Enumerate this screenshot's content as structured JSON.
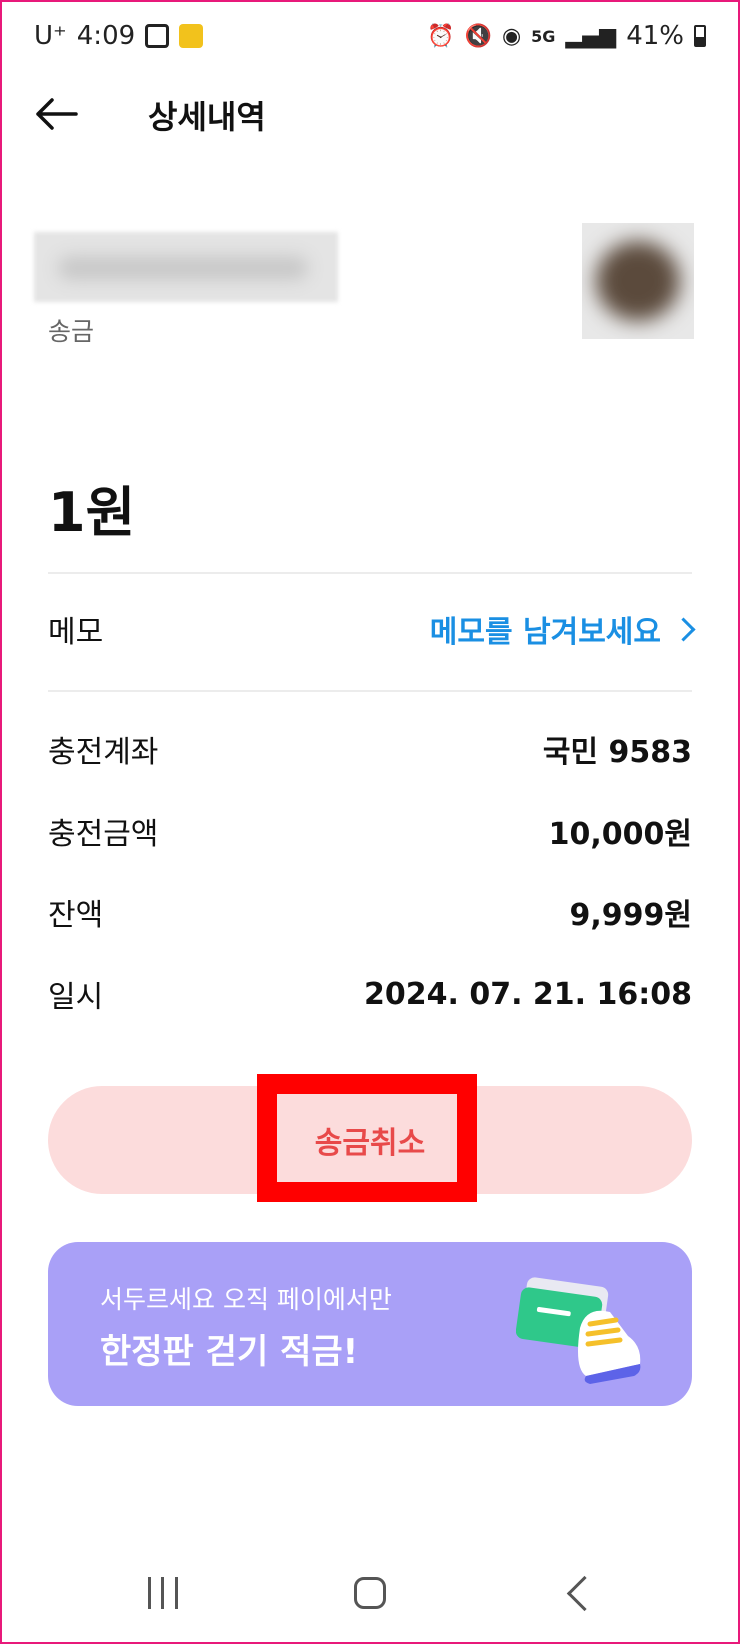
{
  "status_bar": {
    "carrier": "U⁺",
    "time": "4:09",
    "network": "5G",
    "battery": "41%"
  },
  "header": {
    "title": "상세내역"
  },
  "transaction": {
    "type": "송금",
    "amount": "1원"
  },
  "memo": {
    "label": "메모",
    "link": "메모를 남겨보세요"
  },
  "details": [
    {
      "label": "충전계좌",
      "value": "국민 9583"
    },
    {
      "label": "충전금액",
      "value": "10,000원"
    },
    {
      "label": "잔액",
      "value": "9,999원"
    },
    {
      "label": "일시",
      "value": "2024. 07. 21. 16:08"
    }
  ],
  "actions": {
    "cancel_label": "송금취소"
  },
  "banner": {
    "subtitle": "서두르세요 오직 페이에서만",
    "title": "한정판 걷기 적금!"
  },
  "colors": {
    "accent_link": "#1a8fe3",
    "cancel_bg": "#fcdcdc",
    "cancel_text": "#e84a4a",
    "banner_bg": "#a9a0f7",
    "highlight": "#ff0000"
  }
}
